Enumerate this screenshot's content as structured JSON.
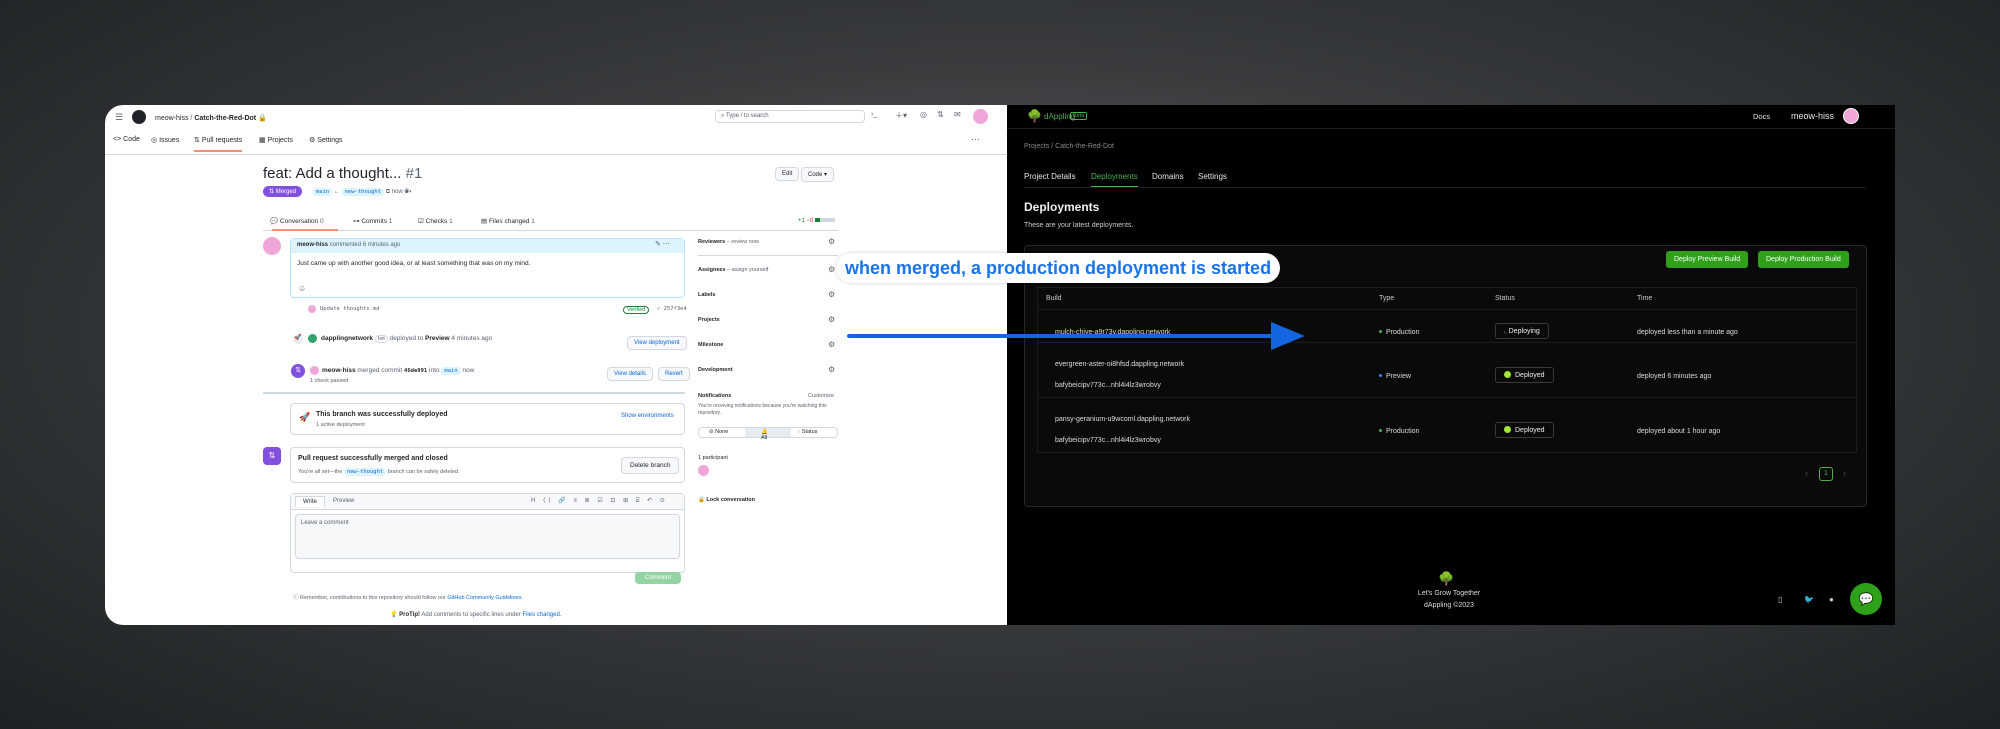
{
  "gh": {
    "owner": "meow-hiss",
    "sep": "/",
    "repo": "Catch-the-Red-Dot",
    "search_placeholder": "Type / to search",
    "tabs": [
      "Code",
      "Issues",
      "Pull requests",
      "Projects",
      "Settings"
    ],
    "pr_title": "feat: Add a thought...",
    "pr_number": "#1",
    "edit": "Edit",
    "code_btn": "Code",
    "merged": "Merged",
    "base": "main",
    "arrow": "←",
    "head": "new-thought",
    "time": "now",
    "pr_tabs": [
      {
        "label": "Conversation",
        "count": "0"
      },
      {
        "label": "Commits",
        "count": "1"
      },
      {
        "label": "Checks",
        "count": "1"
      },
      {
        "label": "Files changed",
        "count": "1"
      }
    ],
    "diff_add": "+1",
    "diff_del": "−0",
    "comment_author": "meow-hiss",
    "comment_meta": "commented 6 minutes ago",
    "comment_body": "Just came up with another good idea, or at least something that was on my mind.",
    "commit_msg": "Update thoughts.md",
    "verified": "Verified",
    "commit_sha": "257f3e4",
    "deploy_bot": "dapplingnetwork",
    "bot": "bot",
    "deploy_text": "deployed to",
    "deploy_env": "Preview",
    "deploy_time": "4 minutes ago",
    "view_deployment": "View deployment",
    "merge_author": "meow-hiss",
    "merge_text": "merged commit",
    "merge_sha": "46de991",
    "into": "into",
    "merge_base": "main",
    "merge_time": "now",
    "check_passed": "1 check passed",
    "view_details": "View details",
    "revert": "Revert",
    "deployed_title": "This branch was successfully deployed",
    "active_deploy": "1 active deployment",
    "show_env": "Show environments",
    "merged_title": "Pull request successfully merged and closed",
    "merged_sub1": "You're all set—the",
    "merged_branch": "new-thought",
    "merged_sub2": "branch can be safely deleted.",
    "delete_branch": "Delete branch",
    "write": "Write",
    "preview": "Preview",
    "comment_placeholder": "Leave a comment",
    "comment_btn": "Comment",
    "remember": "Remember, contributions to this repository should follow our",
    "guidelines": "GitHub Community Guidelines",
    "protip": "ProTip!",
    "protip_text": "Add comments to specific lines under",
    "files_changed": "Files changed",
    "side": {
      "reviewers": "Reviewers",
      "reviewers_val": "– review now",
      "assignees": "Assignees",
      "assignees_val": "– assign yourself",
      "labels": "Labels",
      "projects": "Projects",
      "milestone": "Milestone",
      "development": "Development",
      "notifications": "Notifications",
      "customize": "Customize",
      "notif_text": "You're receiving notifications because you're watching this repository.",
      "none": "None",
      "all": "All",
      "status": "Status",
      "participants": "1 participant",
      "lock": "Lock conversation"
    }
  },
  "callout": "when merged, a production deployment is started",
  "dp": {
    "brand": "dAppling",
    "beta": "Beta",
    "docs": "Docs",
    "user": "meow-hiss",
    "crumb1": "Projects",
    "crumb_sep": "/",
    "crumb2": "Catch-the-Red-Dot",
    "tabs": [
      "Project Details",
      "Deployments",
      "Domains",
      "Settings"
    ],
    "title": "Deployments",
    "subtitle": "These are your latest deployments.",
    "deploy_preview": "Deploy Preview Build",
    "deploy_production": "Deploy Production Build",
    "headers": [
      "Build",
      "Type",
      "Status",
      "Time"
    ],
    "rows": [
      {
        "build": "mulch-chive-a9r73v.dappling.network",
        "cid": "",
        "type": "Production",
        "status": "Deploying",
        "time": "deployed less than a minute ago"
      },
      {
        "build": "evergreen-aster-oi8hfsd.dappling.network",
        "cid": "bafybeicipv773c...nhl4i4lz3wrobvy",
        "type": "Preview",
        "status": "Deployed",
        "time": "deployed 6 minutes ago"
      },
      {
        "build": "pansy-geranium-u9wcoml.dappling.network",
        "cid": "bafybeicipv773c...nhl4i4lz3wrobvy",
        "type": "Production",
        "status": "Deployed",
        "time": "deployed about 1 hour ago"
      }
    ],
    "page": "1",
    "prev": "‹",
    "next": "›",
    "tagline": "Let's Grow Together",
    "copyright": "dAppling ©2023"
  },
  "colors": {
    "accent_green": "#2ea01a",
    "merged_purple": "#8250df",
    "callout_blue": "#1a73e8",
    "arrow_blue": "#1565e0"
  }
}
